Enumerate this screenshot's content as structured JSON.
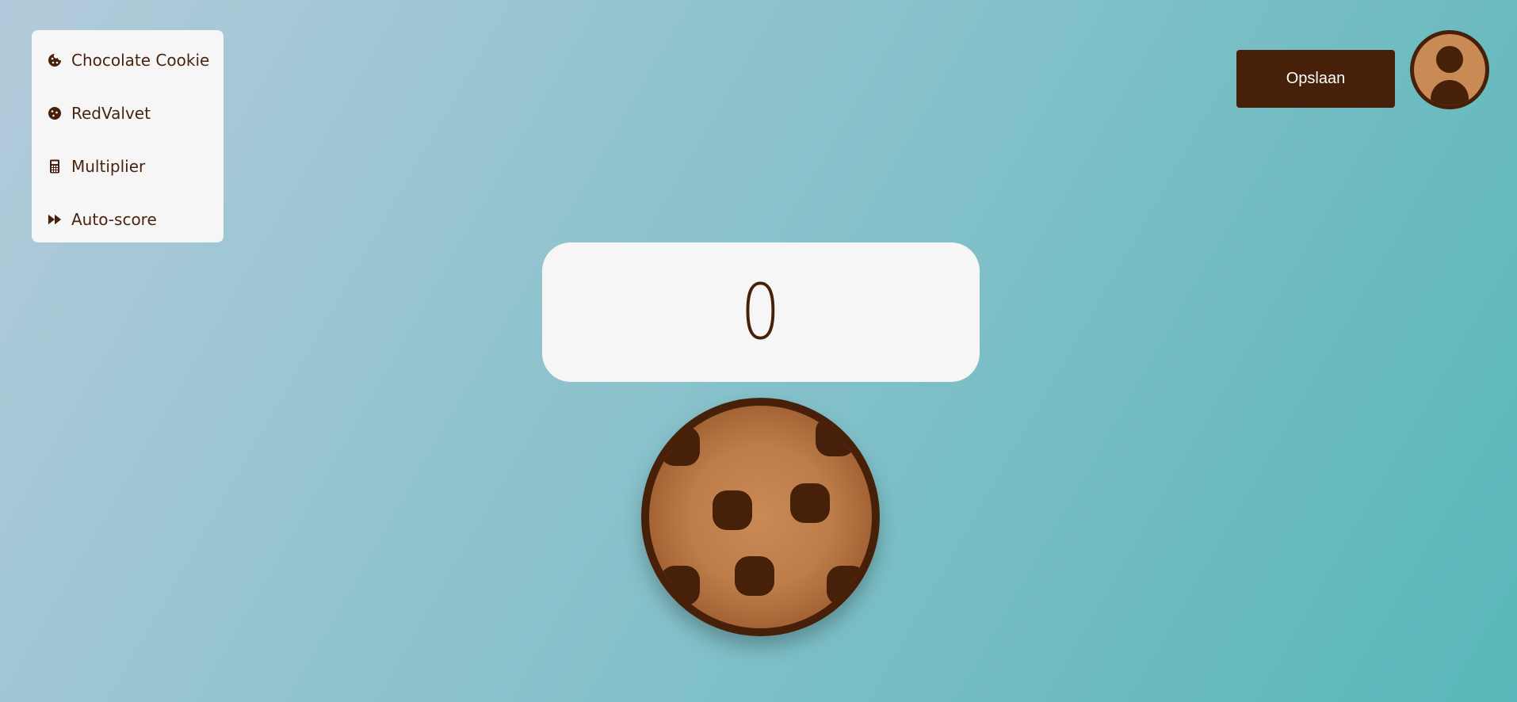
{
  "menu": {
    "items": [
      {
        "label": "Chocolate Cookie",
        "icon": "cookie-bite-icon"
      },
      {
        "label": "RedValvet",
        "icon": "cookie-icon"
      },
      {
        "label": "Multiplier",
        "icon": "calculator-icon"
      },
      {
        "label": "Auto-score",
        "icon": "fast-forward-icon"
      }
    ]
  },
  "header": {
    "save_label": "Opslaan",
    "avatar_icon": "user-avatar-icon"
  },
  "score": {
    "value": "0"
  },
  "cookie": {
    "icon": "cookie-clicker-icon"
  },
  "colors": {
    "brown": "#462009",
    "panel": "#f6f6f6",
    "cookie": "#c98a56"
  }
}
